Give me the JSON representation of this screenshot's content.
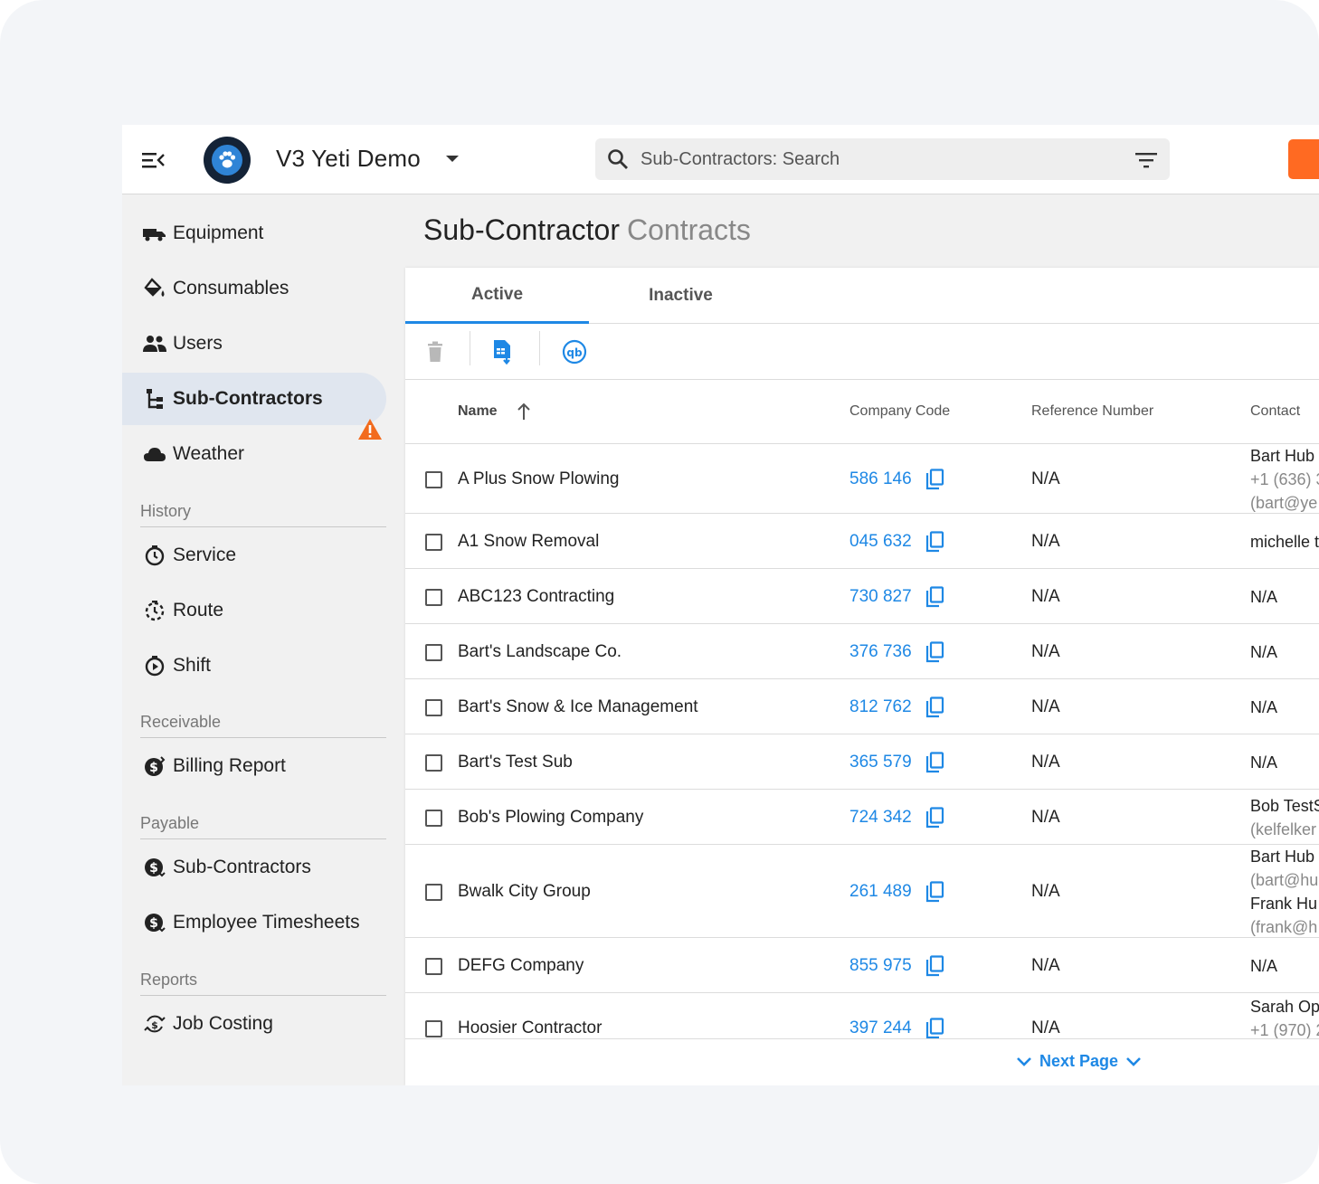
{
  "header": {
    "org_name": "V3 Yeti Demo",
    "search_placeholder": "Sub-Contractors: Search"
  },
  "sidebar": {
    "items": [
      {
        "label": "Equipment",
        "icon": "truck-icon"
      },
      {
        "label": "Consumables",
        "icon": "paint-bucket-icon"
      },
      {
        "label": "Users",
        "icon": "users-icon"
      },
      {
        "label": "Sub-Contractors",
        "icon": "hierarchy-icon",
        "active": true
      },
      {
        "label": "Weather",
        "icon": "cloud-icon"
      }
    ],
    "sections": {
      "history": {
        "label": "History",
        "items": [
          {
            "label": "Service",
            "icon": "history-clock-icon"
          },
          {
            "label": "Route",
            "icon": "history-clock-icon"
          },
          {
            "label": "Shift",
            "icon": "history-clock-icon"
          }
        ]
      },
      "receivable": {
        "label": "Receivable",
        "items": [
          {
            "label": "Billing Report",
            "icon": "dollar-icon"
          }
        ]
      },
      "payable": {
        "label": "Payable",
        "items": [
          {
            "label": "Sub-Contractors",
            "icon": "dollar-icon"
          },
          {
            "label": "Employee Timesheets",
            "icon": "dollar-icon"
          }
        ]
      },
      "reports": {
        "label": "Reports",
        "items": [
          {
            "label": "Job Costing",
            "icon": "dollar-cycle-icon"
          }
        ]
      }
    }
  },
  "page": {
    "title_main": "Sub-Contractor",
    "title_sub": "Contracts"
  },
  "tabs": [
    {
      "label": "Active",
      "active": true
    },
    {
      "label": "Inactive",
      "active": false
    }
  ],
  "table": {
    "columns": {
      "name": "Name",
      "company_code": "Company Code",
      "reference_number": "Reference Number",
      "contact": "Contact"
    },
    "rows": [
      {
        "name": "A Plus Snow Plowing",
        "code": "586 146",
        "ref": "N/A",
        "contact": [
          "Bart Hub",
          "+1 (636) 3",
          "(bart@ye"
        ]
      },
      {
        "name": "A1 Snow Removal",
        "code": "045 632",
        "ref": "N/A",
        "contact": [
          "michelle t"
        ]
      },
      {
        "name": "ABC123 Contracting",
        "code": "730 827",
        "ref": "N/A",
        "contact": [
          "N/A"
        ]
      },
      {
        "name": "Bart's Landscape Co.",
        "code": "376 736",
        "ref": "N/A",
        "contact": [
          "N/A"
        ]
      },
      {
        "name": "Bart's Snow & Ice Management",
        "code": "812 762",
        "ref": "N/A",
        "contact": [
          "N/A"
        ]
      },
      {
        "name": "Bart's Test Sub",
        "code": "365 579",
        "ref": "N/A",
        "contact": [
          "N/A"
        ]
      },
      {
        "name": "Bob's Plowing Company",
        "code": "724 342",
        "ref": "N/A",
        "contact": [
          "Bob TestS",
          "(kelfelker"
        ]
      },
      {
        "name": "Bwalk City Group",
        "code": "261 489",
        "ref": "N/A",
        "contact": [
          "Bart Hub",
          "(bart@hu",
          "Frank Hu",
          "(frank@h"
        ]
      },
      {
        "name": "DEFG Company",
        "code": "855 975",
        "ref": "N/A",
        "contact": [
          "N/A"
        ]
      },
      {
        "name": "Hoosier Contractor",
        "code": "397 244",
        "ref": "N/A",
        "contact": [
          "Sarah Op",
          "+1 (970) 2"
        ]
      }
    ]
  },
  "footer": {
    "next_page": "Next Page"
  },
  "colors": {
    "accent": "#1e88e5",
    "brand_orange": "#ff6a22",
    "warning": "#f26b1d",
    "logo_bg": "#142337"
  }
}
